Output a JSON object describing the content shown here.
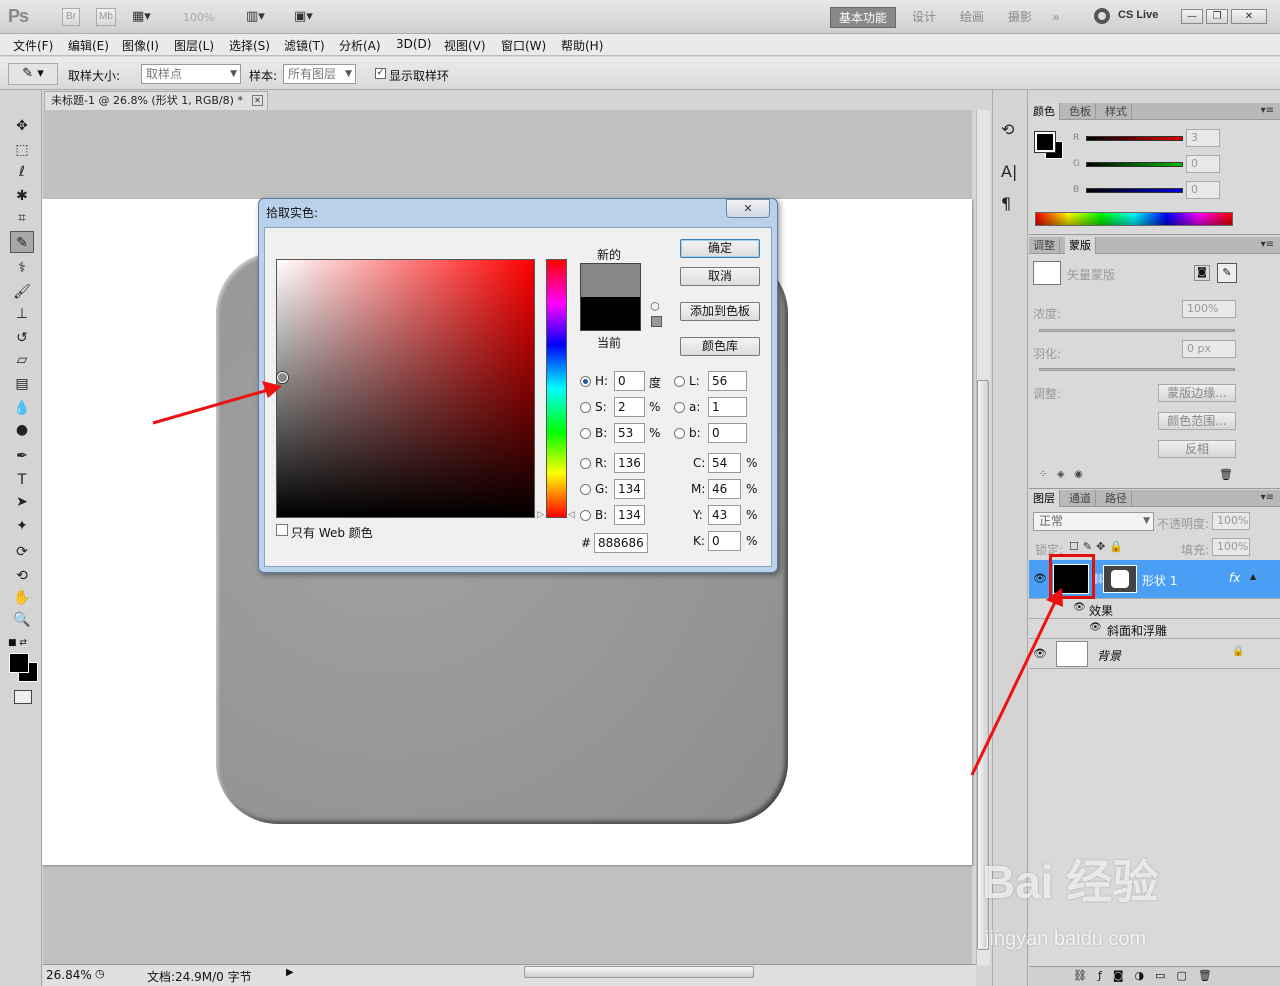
{
  "app": {
    "logo": "Ps",
    "bridge": "Br",
    "minibridge": "Mb",
    "zoom_select": "100%",
    "workspaces": [
      "基本功能",
      "设计",
      "绘画",
      "摄影"
    ],
    "more": "»",
    "cslive": "CS Live",
    "window_buttons": [
      "—",
      "❐",
      "✕"
    ]
  },
  "menu": [
    "文件(F)",
    "编辑(E)",
    "图像(I)",
    "图层(L)",
    "选择(S)",
    "滤镜(T)",
    "分析(A)",
    "3D(D)",
    "视图(V)",
    "窗口(W)",
    "帮助(H)"
  ],
  "options": {
    "sample_size_label": "取样大小:",
    "sample_size_value": "取样点",
    "sample_label": "样本:",
    "sample_value": "所有图层",
    "show_ring_label": "显示取样环"
  },
  "document": {
    "tab_title": "未标题-1 @ 26.8% (形状 1, RGB/8) *",
    "zoom": "26.84%",
    "doc_size": "文档:24.9M/0 字节"
  },
  "color_panel": {
    "tabs": [
      "颜色",
      "色板",
      "样式"
    ],
    "channels": [
      {
        "label": "R",
        "value": "3",
        "color": "#e00000"
      },
      {
        "label": "G",
        "value": "0",
        "color": "#00c000"
      },
      {
        "label": "B",
        "value": "0",
        "color": "#0000e0"
      }
    ]
  },
  "masks_panel": {
    "tabs": [
      "调整",
      "蒙版"
    ],
    "mask_type": "矢量蒙版",
    "density_label": "浓度:",
    "density_value": "100%",
    "feather_label": "羽化:",
    "feather_value": "0 px",
    "adjust_label": "调整:",
    "mask_edge_btn": "蒙版边缘...",
    "color_range_btn": "颜色范围...",
    "invert_btn": "反相"
  },
  "layers_panel": {
    "tabs": [
      "图层",
      "通道",
      "路径"
    ],
    "blend_mode": "正常",
    "opacity_label": "不透明度:",
    "opacity_value": "100%",
    "lock_label": "锁定:",
    "fill_label": "填充:",
    "fill_value": "100%",
    "layers": [
      {
        "name": "形状 1",
        "fx": "fx",
        "selected": true
      },
      {
        "name": "效果",
        "sub": true
      },
      {
        "name": "斜面和浮雕",
        "sub2": true
      },
      {
        "name": "背景",
        "locked": true
      }
    ]
  },
  "color_picker": {
    "title": "拾取实色:",
    "close": "✕",
    "new_label": "新的",
    "current_label": "当前",
    "new_color": "#888686",
    "current_color": "#000000",
    "ok_btn": "确定",
    "cancel_btn": "取消",
    "add_swatch_btn": "添加到色板",
    "color_lib_btn": "颜色库",
    "web_only_label": "只有 Web 颜色",
    "H": "0",
    "H_unit": "度",
    "S": "2",
    "S_unit": "%",
    "B": "53",
    "B_unit": "%",
    "R": "136",
    "G": "134",
    "Bv": "134",
    "L": "56",
    "a": "1",
    "b": "0",
    "C": "54",
    "M": "46",
    "Y": "43",
    "K": "0",
    "pct": "%",
    "hex": "888686"
  },
  "watermark": {
    "brand": "Bai 经验",
    "url": "jingyan.baidu.com"
  }
}
